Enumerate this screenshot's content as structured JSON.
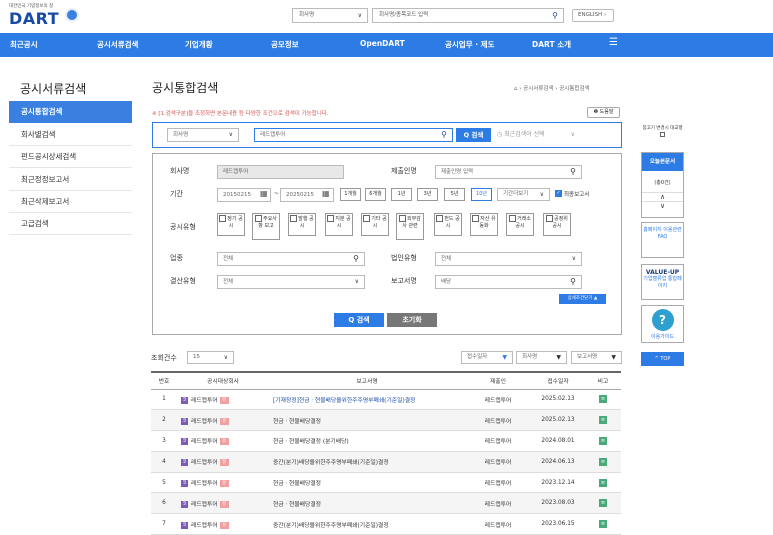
{
  "header": {
    "logo_sub": "대한민국 기업정보의 창",
    "logo": "DART",
    "search_type": "회사명",
    "search_placeholder": "회사명/종목코드 입력",
    "english_btn": "ENGLISH ›"
  },
  "nav": [
    "최근공시",
    "공시서류검색",
    "기업개황",
    "공모정보",
    "OpenDART",
    "공시업무 · 제도",
    "DART 소개",
    "☰"
  ],
  "sidebar": {
    "title": "공시서류검색",
    "items": [
      "공시통합검색",
      "회사별검색",
      "펀드공시상세검색",
      "최근정정보고서",
      "최근삭제보고서",
      "고급검색"
    ]
  },
  "main": {
    "title": "공시통합검색",
    "breadcrumb": "⌂ › 공시서류검색 › 공시통합검색",
    "notice": "※ [1.검색구분]을 조정하면 본문내용 등 다양한 조건으로 검색이 가능합니다.",
    "help": "❷ 도움말",
    "top_search": {
      "type": "회사명",
      "value": "레드캡투어",
      "search_btn": "Q 검색",
      "recent": "최근검색어 선택"
    },
    "filter": {
      "company_lbl": "회사명",
      "company_val": "레드캡투어",
      "submitter_lbl": "제출인명",
      "submitter_ph": "제출인명 입력",
      "period_lbl": "기간",
      "date_from": "20150215",
      "date_to": "20250215",
      "periods": [
        "1개월",
        "6개월",
        "1년",
        "3년",
        "5년",
        "10년"
      ],
      "period_more": "기간더보기",
      "final_report": "최종보고서",
      "type_lbl": "공시유형",
      "types": [
        "정기 공시",
        "주요사항 보고",
        "발행 공시",
        "지분 공시",
        "기타 공시",
        "외부감사 관련",
        "펀드 공시",
        "자산 유동화",
        "거래소 공시",
        "공정위 공시"
      ],
      "industry_lbl": "업종",
      "industry_val": "전체",
      "corp_type_lbl": "법인유형",
      "corp_type_val": "전체",
      "fiscal_lbl": "결산유형",
      "fiscal_val": "전체",
      "report_lbl": "보고서명",
      "report_val": "배당",
      "detail_btn": "상세조건닫기 ▲",
      "search_btn": "Q 검색",
      "reset_btn": "초기화"
    },
    "results": {
      "count_lbl": "조회건수",
      "count_val": "15",
      "sort1": "접수일자",
      "sort2": "회사명",
      "sort3": "보고서명",
      "columns": [
        "번호",
        "공시대상회사",
        "보고서명",
        "제출인",
        "접수일자",
        "비고"
      ],
      "rows": [
        {
          "no": "1",
          "company": "레드캡투어",
          "report": "[기재정정]현금ㆍ현물배당을위한주주명부폐쇄(기준일)결정",
          "submitter": "레드캡투어",
          "date": "2025.02.13",
          "link": true
        },
        {
          "no": "2",
          "company": "레드캡투어",
          "report": "현금ㆍ현물배당결정",
          "submitter": "레드캡투어",
          "date": "2025.02.13",
          "link": false
        },
        {
          "no": "3",
          "company": "레드캡투어",
          "report": "현금ㆍ현물배당결정 (분기배당)",
          "submitter": "레드캡투어",
          "date": "2024.08.01",
          "link": false
        },
        {
          "no": "4",
          "company": "레드캡투어",
          "report": "중간(분기)배당을위한주주명부폐쇄(기준일)결정",
          "submitter": "레드캡투어",
          "date": "2024.06.13",
          "link": false
        },
        {
          "no": "5",
          "company": "레드캡투어",
          "report": "현금ㆍ현물배당결정",
          "submitter": "레드캡투어",
          "date": "2023.12.14",
          "link": false
        },
        {
          "no": "6",
          "company": "레드캡투어",
          "report": "현금ㆍ현물배당결정",
          "submitter": "레드캡투어",
          "date": "2023.08.03",
          "link": false
        },
        {
          "no": "7",
          "company": "레드캡투어",
          "report": "중간(분기)배당을위한주주명부폐쇄(기준일)결정",
          "submitter": "레드캡투어",
          "date": "2023.06.15",
          "link": false
        }
      ],
      "company_icon": "코",
      "yu_icon": "유",
      "note_icon": "≡"
    }
  },
  "right": {
    "compare_lbl": "참고기 변경시 대교행",
    "report_box_title": "오늘본문서",
    "report_count": "(총0건)",
    "faq": "홈페이지 이용관련 FAQ",
    "value_up": "VALUE-UP",
    "value_sub": "기업밸류업 통합페이지",
    "guide": "이용가이드",
    "top": "^ TOP"
  }
}
